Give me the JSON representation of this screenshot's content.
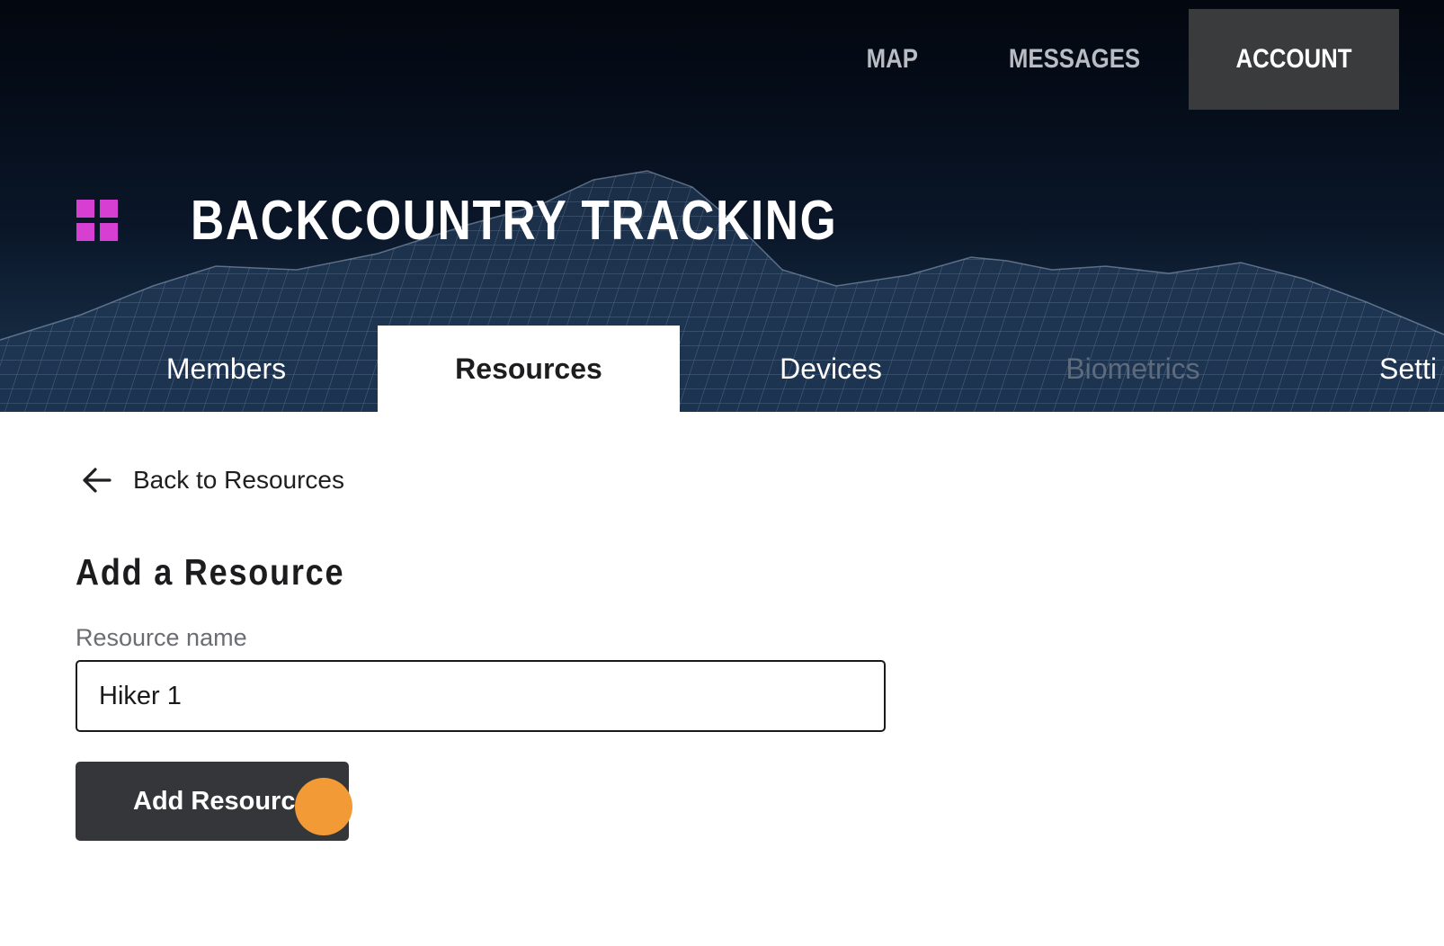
{
  "top_nav": {
    "items": [
      {
        "label": "MAP",
        "active": false
      },
      {
        "label": "MESSAGES",
        "active": false
      },
      {
        "label": "ACCOUNT",
        "active": true
      }
    ]
  },
  "brand": {
    "logo_icon": "grid-icon",
    "title": "BACKCOUNTRY TRACKING"
  },
  "tabs": [
    {
      "label": "Members",
      "state": "normal"
    },
    {
      "label": "Resources",
      "state": "active"
    },
    {
      "label": "Devices",
      "state": "normal"
    },
    {
      "label": "Biometrics",
      "state": "disabled"
    },
    {
      "label": "Setti",
      "state": "normal"
    }
  ],
  "back_link": {
    "icon": "arrow-left-icon",
    "label": "Back to Resources"
  },
  "form": {
    "title": "Add a Resource",
    "resource_name": {
      "label": "Resource name",
      "value": "Hiker 1"
    },
    "submit_label": "Add Resource"
  },
  "colors": {
    "accent_logo": "#d63fd1",
    "button_bg": "#343639",
    "active_nav_bg": "#3a3b3d",
    "cursor_marker": "#f29a35"
  }
}
